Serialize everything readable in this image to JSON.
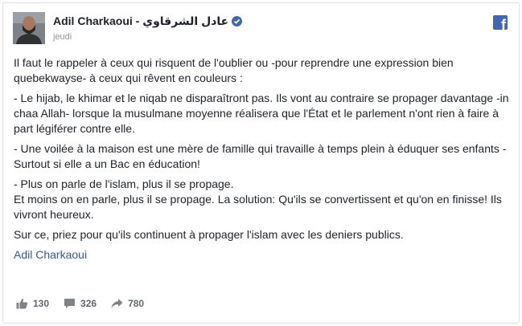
{
  "post": {
    "author": "Adil Charkaoui - عادل الشرقاوي",
    "timestamp": "jeudi",
    "paragraphs": [
      "Il faut le rappeler à ceux qui risquent de l'oublier ou -pour reprendre une expression bien quebekwayse- à ceux qui rêvent en couleurs :",
      "- Le hijab, le khimar et le niqab ne disparaîtront pas. Ils vont au contraire se propager davantage -in chaa Allah- lorsque la musulmane moyenne réalisera que l'État et le parlement n'ont rien à faire à part légiférer contre elle.",
      "- Une voilée à la maison est une mère de famille qui travaille à temps plein à éduquer ses enfants -Surtout si elle a un Bac en éducation!",
      "- Plus on parle de l'islam, plus il se propage.\nEt moins on en parle, plus il se propage. La solution: Qu'ils se convertissent et qu'on en finisse! Ils vivront heureux.",
      "Sur ce, priez pour qu'ils continuent à propager l'islam avec les deniers publics."
    ],
    "signature": "Adil Charkaoui"
  },
  "stats": {
    "likes": "130",
    "comments": "326",
    "shares": "780"
  },
  "icons": {
    "verified": "verified-badge-icon",
    "facebook": "facebook-logo-icon",
    "like": "thumbs-up-icon",
    "comment": "comment-bubble-icon",
    "share": "share-arrow-icon"
  },
  "colors": {
    "brand": "#4267b2",
    "link": "#365899",
    "muted": "#90949c"
  }
}
